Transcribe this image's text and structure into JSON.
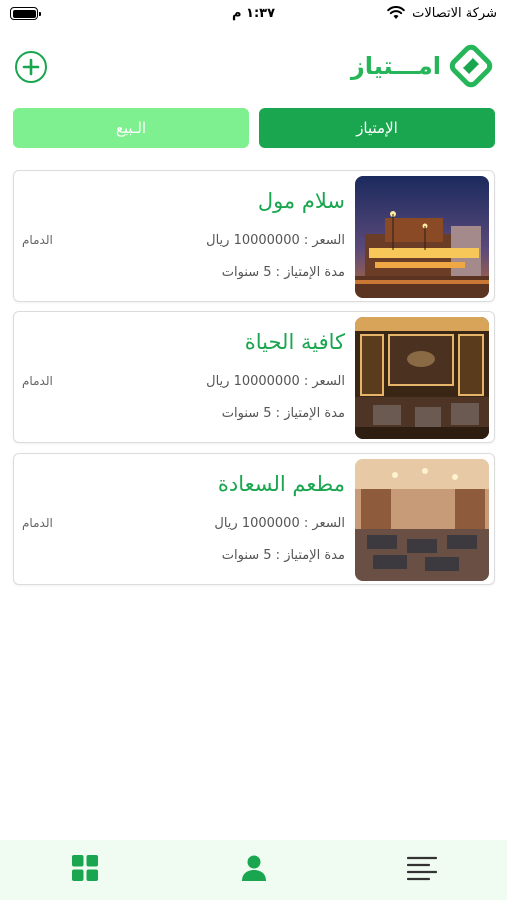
{
  "status_bar": {
    "time": "١:٣٧ م",
    "carrier": "شركة الاتصالات",
    "wifi_icon": "wifi-icon",
    "battery_icon": "battery-icon",
    "battery_level": 1.0
  },
  "header": {
    "logo_text": "امـــتياز",
    "logo_icon": "brand-logo-icon",
    "add_icon": "plus-circle-icon"
  },
  "tabs": [
    {
      "label": "الإمتياز",
      "active": true
    },
    {
      "label": "الـبيع",
      "active": false
    }
  ],
  "listings": [
    {
      "title": "سلام مول",
      "price": "السعر : 10000000 ريال",
      "duration": "مدة الإمتياز : 5 سنوات",
      "city": "الدمام",
      "image_icon": "mall-photo"
    },
    {
      "title": "كافية الحياة",
      "price": "السعر : 10000000 ريال",
      "duration": "مدة الإمتياز : 5 سنوات",
      "city": "الدمام",
      "image_icon": "cafe-photo"
    },
    {
      "title": "مطعم السعادة",
      "price": "السعر : 1000000 ريال",
      "duration": "مدة الإمتياز : 5 سنوات",
      "city": "الدمام",
      "image_icon": "restaurant-photo"
    }
  ],
  "bottom_nav": [
    {
      "icon": "grid-icon"
    },
    {
      "icon": "user-icon"
    },
    {
      "icon": "menu-icon"
    }
  ],
  "colors": {
    "primary": "#1aa64f",
    "light_green": "#7ef08f",
    "logo_green": "#26b659",
    "nav_background": "#f0fcf2"
  }
}
